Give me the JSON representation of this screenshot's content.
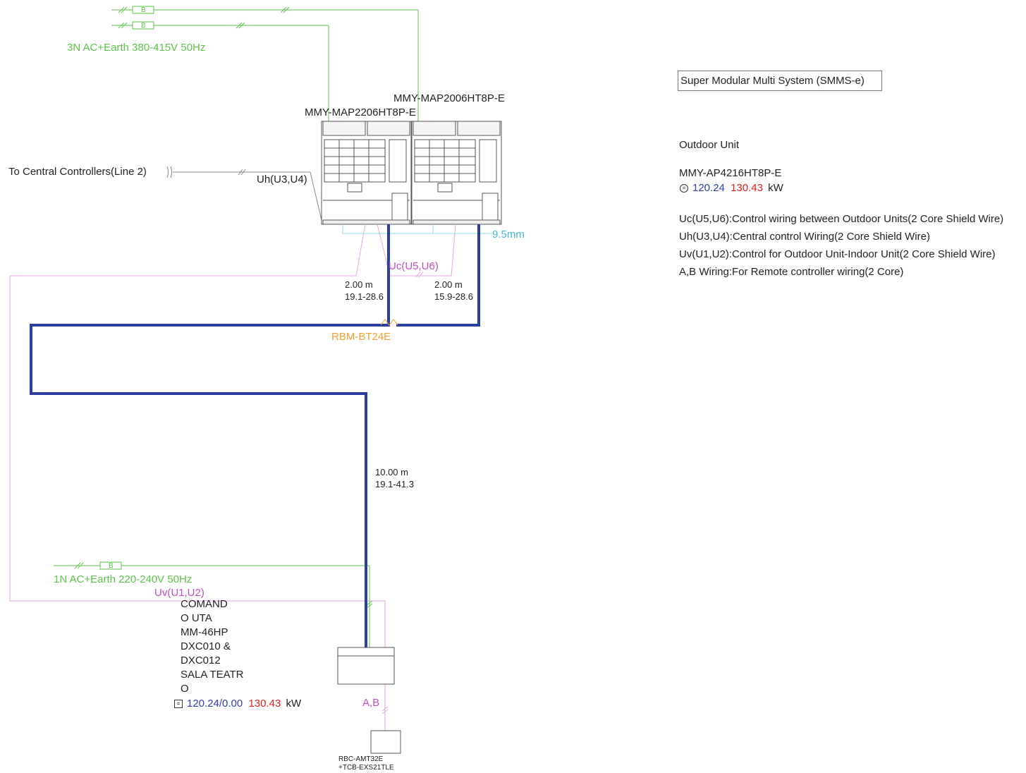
{
  "system_title": "Super Modular Multi System (SMMS-e)",
  "power_supply_3n": "3N AC+Earth 380-415V 50Hz",
  "power_supply_1n": "1N AC+Earth 220-240V 50Hz",
  "breaker_label": "B",
  "outdoor_models": {
    "unit_1": "MMY-MAP2206HT8P-E",
    "unit_2": "MMY-MAP2006HT8P-E"
  },
  "central_controller": "To Central Controllers(Line 2)",
  "wire_labels": {
    "uh": "Uh(U3,U4)",
    "uc": "Uc(U5,U6)",
    "uv": "Uv(U1,U2)",
    "ab": "A,B"
  },
  "pipe_labels": {
    "oil_pipe": "9.5mm",
    "left_length": "2.00 m",
    "left_size": "19.1-28.6",
    "right_length": "2.00 m",
    "right_size": "15.9-28.6",
    "main_length": "10.00 m",
    "main_size": "19.1-41.3"
  },
  "branch_joint": "RBM-BT24E",
  "indoor_unit": {
    "name_lines": [
      "COMAND",
      "O UTA",
      "MM-46HP",
      "DXC010 &",
      "DXC012",
      "SALA TEATR",
      "O"
    ],
    "capacity_cool": "120.24/0.00",
    "capacity_heat": "130.43",
    "unit": "kW"
  },
  "remote_controller": {
    "line1": "RBC-AMT32E",
    "line2": "+TCB-EXS21TLE"
  },
  "legend": {
    "section_title": "Outdoor Unit",
    "model": "MMY-AP4216HT8P-E",
    "capacity_cool": "120.24",
    "capacity_heat": "130.43",
    "unit": "kW",
    "notes": [
      "Uc(U5,U6):Control wiring between Outdoor Units(2 Core Shield Wire)",
      "Uh(U3,U4):Central control Wiring(2 Core Shield Wire)",
      "Uv(U1,U2):Control for Outdoor Unit-Indoor Unit(2 Core Shield Wire)",
      "A,B Wiring:For Remote controller wiring(2 Core)"
    ]
  },
  "colors": {
    "power_wire": "#5cc24a",
    "control_wire": "#e0a0e0",
    "refrigerant_pipe": "#2a3f9f",
    "label_magenta": "#c04fc0",
    "label_orange": "#f0a030",
    "label_cyan": "#40b8d8",
    "cool_value": "#3040b0",
    "heat_value": "#e02020"
  }
}
